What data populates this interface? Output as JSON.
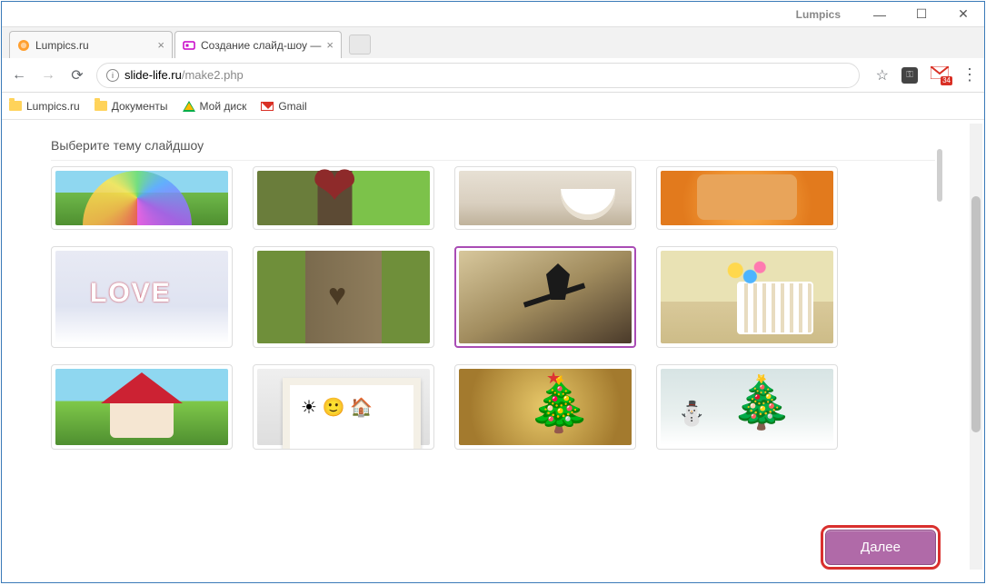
{
  "window": {
    "brand": "Lumpics"
  },
  "tabs": [
    {
      "title": "Lumpics.ru",
      "active": false
    },
    {
      "title": "Создание слайд-шоу —",
      "active": true
    }
  ],
  "address": {
    "host": "slide-life.ru",
    "path": "/make2.php"
  },
  "gmail_badge": "34",
  "bookmarks": [
    {
      "label": "Lumpics.ru",
      "kind": "folder"
    },
    {
      "label": "Документы",
      "kind": "folder"
    },
    {
      "label": "Мой диск",
      "kind": "gdrive"
    },
    {
      "label": "Gmail",
      "kind": "gmail"
    }
  ],
  "page": {
    "heading": "Выберите тему слайдшоу",
    "next_label": "Далее",
    "selected_index": 6,
    "themes": [
      {
        "name": "rainbow"
      },
      {
        "name": "tree-heart"
      },
      {
        "name": "cafe-cup"
      },
      {
        "name": "birthday-cake"
      },
      {
        "name": "love-hearts"
      },
      {
        "name": "bark-heart"
      },
      {
        "name": "street-lamp"
      },
      {
        "name": "nursery-crib"
      },
      {
        "name": "mushroom-house"
      },
      {
        "name": "kids-drawing"
      },
      {
        "name": "christmas-gold"
      },
      {
        "name": "christmas-snow"
      }
    ]
  }
}
